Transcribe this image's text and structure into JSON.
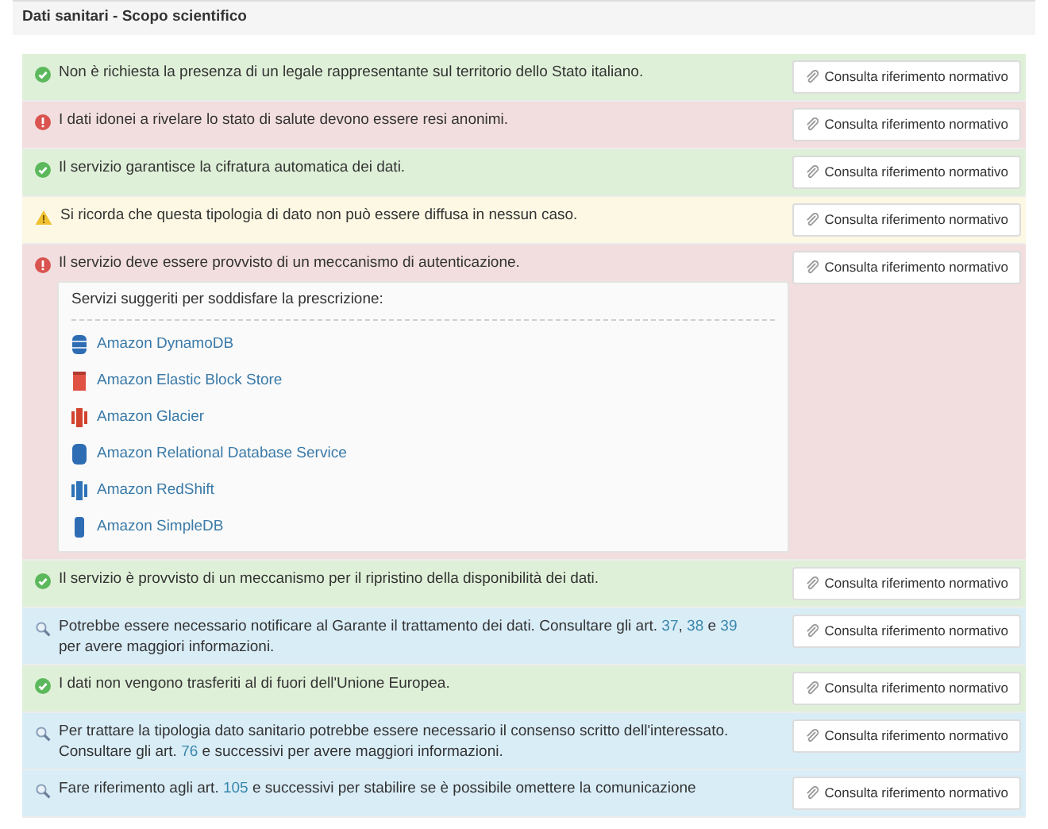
{
  "header": {
    "title": "Dati sanitari - Scopo scientifico"
  },
  "rows": [
    {
      "kind": "ok",
      "parts": [
        {
          "kind": "text",
          "text": "Non è richiesta la presenza di un legale rappresentante sul territorio dello Stato italiano."
        }
      ],
      "button": "Consulta riferimento normativo"
    },
    {
      "kind": "error",
      "parts": [
        {
          "kind": "text",
          "text": "I dati idonei a rivelare lo stato di salute devono essere resi anonimi."
        }
      ],
      "button": "Consulta riferimento normativo"
    },
    {
      "kind": "ok",
      "parts": [
        {
          "kind": "text",
          "text": "Il servizio garantisce la cifratura automatica dei dati."
        }
      ],
      "button": "Consulta riferimento normativo"
    },
    {
      "kind": "warning",
      "parts": [
        {
          "kind": "text",
          "text": "Si ricorda che questa tipologia di dato non può essere diffusa in nessun caso."
        }
      ],
      "button": "Consulta riferimento normativo"
    },
    {
      "kind": "error",
      "parts": [
        {
          "kind": "text",
          "text": "Il servizio deve essere provvisto di un meccanismo di autenticazione."
        }
      ],
      "button": "Consulta riferimento normativo",
      "suggestions": {
        "title": "Servizi suggeriti per soddisfare la prescrizione:",
        "services": [
          {
            "name": "Amazon DynamoDB",
            "kind": "stack",
            "color": "#2e6db4"
          },
          {
            "name": "Amazon Elastic Block Store",
            "kind": "block",
            "color": "#e05243"
          },
          {
            "name": "Amazon Glacier",
            "kind": "bars",
            "color": "#d2432e"
          },
          {
            "name": "Amazon Relational Database Service",
            "kind": "cylinder",
            "color": "#2e6db4"
          },
          {
            "name": "Amazon RedShift",
            "kind": "bars",
            "color": "#2e73b8"
          },
          {
            "name": "Amazon SimpleDB",
            "kind": "tube",
            "color": "#2e6db4"
          }
        ]
      }
    },
    {
      "kind": "ok",
      "parts": [
        {
          "kind": "text",
          "text": "Il servizio è provvisto di un meccanismo per il ripristino della disponibilità dei dati."
        }
      ],
      "button": "Consulta riferimento normativo"
    },
    {
      "kind": "info",
      "parts": [
        {
          "kind": "text",
          "text": "Potrebbe essere necessario notificare al Garante il trattamento dei dati. Consultare gli art. "
        },
        {
          "kind": "link",
          "text": "37"
        },
        {
          "kind": "text",
          "text": ", "
        },
        {
          "kind": "link",
          "text": "38"
        },
        {
          "kind": "text",
          "text": " e "
        },
        {
          "kind": "link",
          "text": "39"
        },
        {
          "kind": "text",
          "text": " per avere maggiori informazioni."
        }
      ],
      "button": "Consulta riferimento normativo"
    },
    {
      "kind": "ok",
      "parts": [
        {
          "kind": "text",
          "text": "I dati non vengono trasferiti al di fuori dell'Unione Europea."
        }
      ],
      "button": "Consulta riferimento normativo"
    },
    {
      "kind": "info",
      "parts": [
        {
          "kind": "text",
          "text": "Per trattare la tipologia dato sanitario potrebbe essere necessario il consenso scritto dell'interessato. Consultare gli art. "
        },
        {
          "kind": "link",
          "text": "76"
        },
        {
          "kind": "text",
          "text": " e successivi per avere maggiori informazioni."
        }
      ],
      "button": "Consulta riferimento normativo"
    },
    {
      "kind": "info",
      "parts": [
        {
          "kind": "text",
          "text": "Fare riferimento agli art. "
        },
        {
          "kind": "link",
          "text": "105"
        },
        {
          "kind": "text",
          "text": " e successivi per stabilire se è possibile omettere la comunicazione"
        }
      ],
      "button": "Consulta riferimento normativo"
    }
  ]
}
